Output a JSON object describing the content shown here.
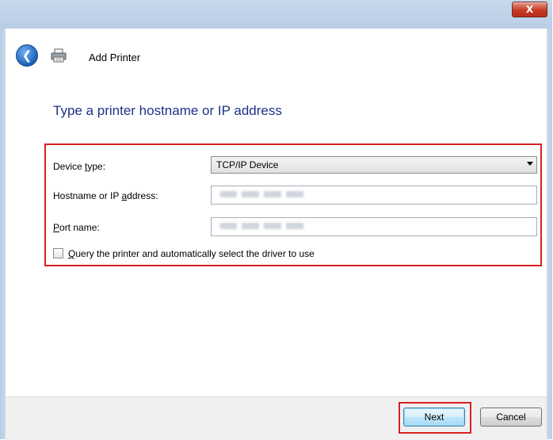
{
  "window": {
    "close_label": "X",
    "title": "Add Printer"
  },
  "heading": "Type a printer hostname or IP address",
  "form": {
    "device_type": {
      "label_prefix": "Device ",
      "label_key": "t",
      "label_suffix": "ype:",
      "value": "TCP/IP Device"
    },
    "hostname": {
      "label_prefix": "Hostname or IP ",
      "label_key": "a",
      "label_suffix": "ddress:"
    },
    "port": {
      "label_key": "P",
      "label_suffix": "ort name:"
    },
    "query": {
      "label_key": "Q",
      "label_suffix": "uery the printer and automatically select the driver to use",
      "checked": false
    }
  },
  "buttons": {
    "next": "Next",
    "cancel": "Cancel"
  },
  "colors": {
    "heading": "#1e3287",
    "highlight": "#d91f1f"
  },
  "icons": {
    "back": "back-arrow-icon",
    "printer": "printer-icon"
  }
}
